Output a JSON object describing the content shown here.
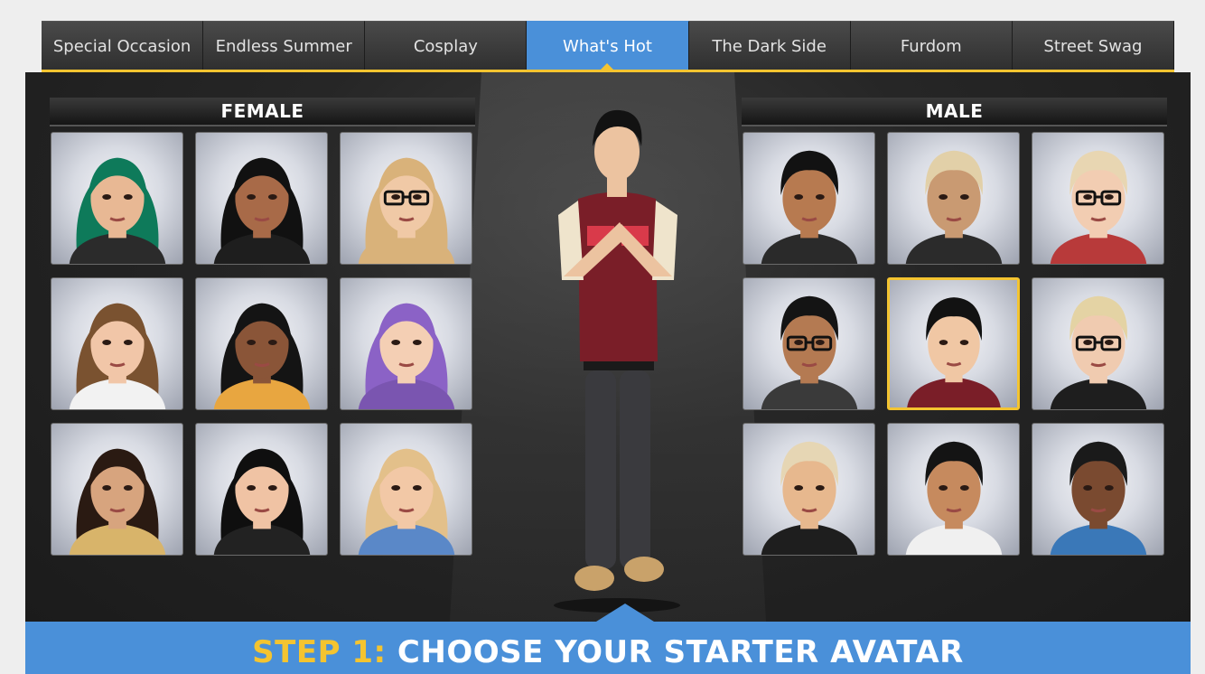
{
  "tabs": [
    {
      "label": "Special Occasion",
      "active": false
    },
    {
      "label": "Endless Summer",
      "active": false
    },
    {
      "label": "Cosplay",
      "active": false
    },
    {
      "label": "What's Hot",
      "active": true
    },
    {
      "label": "The Dark Side",
      "active": false
    },
    {
      "label": "Furdom",
      "active": false
    },
    {
      "label": "Street Swag",
      "active": false
    }
  ],
  "female": {
    "heading": "FEMALE",
    "avatars": [
      {
        "hair": "#0e7a5a",
        "skin": "#e8b894",
        "outfit": "#2b2b2b",
        "glasses": false
      },
      {
        "hair": "#111111",
        "skin": "#a86a48",
        "outfit": "#1e1e1e",
        "glasses": false
      },
      {
        "hair": "#d9b27a",
        "skin": "#f0c9a6",
        "outfit": "#d9b27a",
        "glasses": true
      },
      {
        "hair": "#7a5230",
        "skin": "#f1c6a8",
        "outfit": "#f2f2f2",
        "glasses": false
      },
      {
        "hair": "#141414",
        "skin": "#8a5538",
        "outfit": "#e8a640",
        "glasses": false
      },
      {
        "hair": "#8b62c6",
        "skin": "#f4cfb4",
        "outfit": "#7a55b0",
        "glasses": false
      },
      {
        "hair": "#2a1a12",
        "skin": "#d7a47e",
        "outfit": "#d8b46a",
        "glasses": false
      },
      {
        "hair": "#0f0f0f",
        "skin": "#f0c3a4",
        "outfit": "#222222",
        "glasses": false
      },
      {
        "hair": "#e3c08a",
        "skin": "#f2c8a6",
        "outfit": "#5a88c8",
        "glasses": false
      }
    ]
  },
  "male": {
    "heading": "MALE",
    "avatars": [
      {
        "hair": "#121212",
        "skin": "#b77a50",
        "outfit": "#2a2a2a",
        "glasses": false,
        "selected": false
      },
      {
        "hair": "#e2d0a8",
        "skin": "#c99a72",
        "outfit": "#2b2b2b",
        "glasses": false,
        "selected": false
      },
      {
        "hair": "#e8d6b2",
        "skin": "#f2cdb2",
        "outfit": "#b83a3a",
        "glasses": true,
        "selected": false
      },
      {
        "hair": "#141414",
        "skin": "#b47a52",
        "outfit": "#3a3a3a",
        "glasses": true,
        "selected": false
      },
      {
        "hair": "#121212",
        "skin": "#f0c7a4",
        "outfit": "#7a1e28",
        "glasses": false,
        "selected": true
      },
      {
        "hair": "#e4d3a4",
        "skin": "#f0cbb0",
        "outfit": "#1e1e1e",
        "glasses": true,
        "selected": false
      },
      {
        "hair": "#e6d6b4",
        "skin": "#e7b88e",
        "outfit": "#1e1e1e",
        "glasses": false,
        "selected": false
      },
      {
        "hair": "#141414",
        "skin": "#c68a5e",
        "outfit": "#f0f0f0",
        "glasses": false,
        "selected": false
      },
      {
        "hair": "#1a1a1a",
        "skin": "#7a4a30",
        "outfit": "#3a78b8",
        "glasses": false,
        "selected": false
      }
    ]
  },
  "preview": {
    "hair": "#121212",
    "skin": "#ecc3a0",
    "shirt": "#7a1e28",
    "sleeves": "#efe4cc",
    "pants": "#3a3a3e",
    "shoes": "#c9a26a"
  },
  "banner": {
    "step": "STEP 1:",
    "text": " CHOOSE YOUR STARTER AVATAR"
  },
  "colors": {
    "accent": "#4a90d9",
    "highlight": "#f4c430",
    "tab_bg": "#3b3b3b"
  }
}
